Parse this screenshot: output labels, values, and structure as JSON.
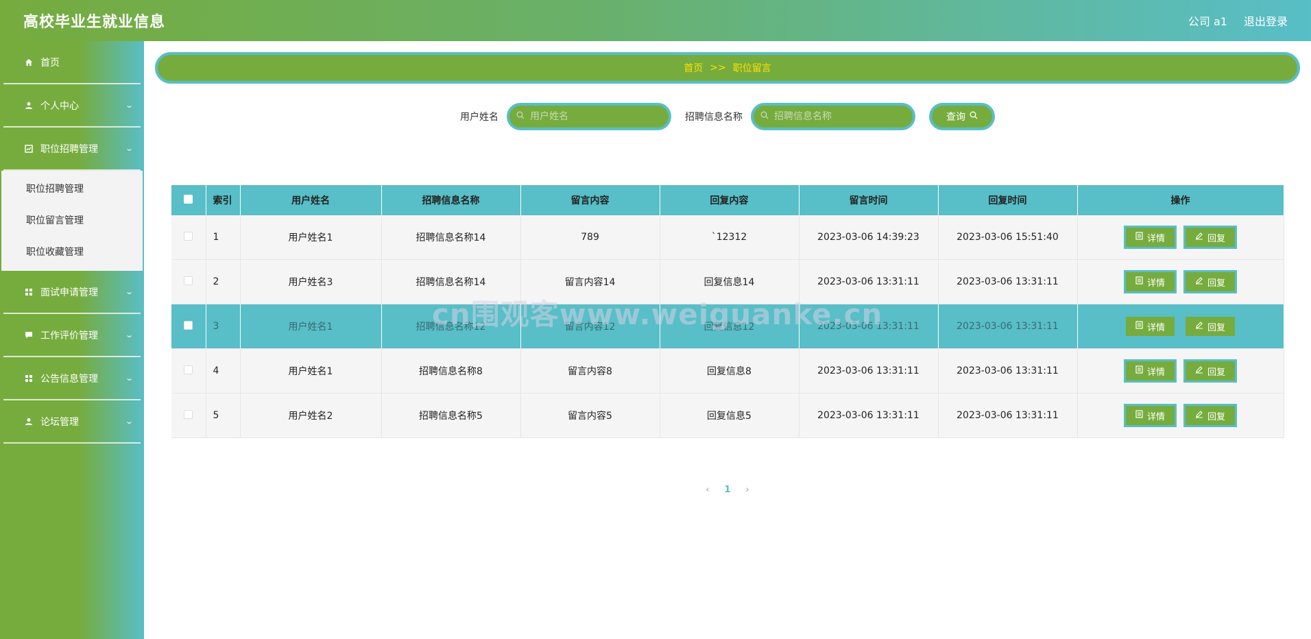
{
  "header": {
    "title": "高校毕业生就业信息",
    "user_label": "公司 a1",
    "logout_label": "退出登录"
  },
  "sidebar": {
    "items": [
      {
        "label": "首页",
        "icon": "home-icon",
        "has_chevron": false
      },
      {
        "label": "个人中心",
        "icon": "user-icon",
        "has_chevron": true
      },
      {
        "label": "职位招聘管理",
        "icon": "chart-icon",
        "has_chevron": true
      }
    ],
    "submenu": [
      {
        "label": "职位招聘管理"
      },
      {
        "label": "职位留言管理"
      },
      {
        "label": "职位收藏管理"
      }
    ],
    "items_after": [
      {
        "label": "面试申请管理",
        "icon": "grid-icon",
        "has_chevron": true
      },
      {
        "label": "工作评价管理",
        "icon": "message-icon",
        "has_chevron": true
      },
      {
        "label": "公告信息管理",
        "icon": "grid-icon",
        "has_chevron": true
      },
      {
        "label": "论坛管理",
        "icon": "user-icon",
        "has_chevron": true
      }
    ]
  },
  "breadcrumb": {
    "home": "首页",
    "sep": ">>",
    "current": "职位留言"
  },
  "search": {
    "username_label": "用户姓名",
    "username_placeholder": "用户姓名",
    "recruit_label": "招聘信息名称",
    "recruit_placeholder": "招聘信息名称",
    "query_label": "查询"
  },
  "table": {
    "columns": [
      "索引",
      "用户姓名",
      "招聘信息名称",
      "留言内容",
      "回复内容",
      "留言时间",
      "回复时间",
      "操作"
    ],
    "rows": [
      {
        "index": "1",
        "username": "用户姓名1",
        "recruit": "招聘信息名称14",
        "message": "789",
        "reply": "`12312",
        "msg_time": "2023-03-06 14:39:23",
        "reply_time": "2023-03-06 15:51:40",
        "highlight": false
      },
      {
        "index": "2",
        "username": "用户姓名3",
        "recruit": "招聘信息名称14",
        "message": "留言内容14",
        "reply": "回复信息14",
        "msg_time": "2023-03-06 13:31:11",
        "reply_time": "2023-03-06 13:31:11",
        "highlight": false
      },
      {
        "index": "3",
        "username": "用户姓名1",
        "recruit": "招聘信息名称12",
        "message": "留言内容12",
        "reply": "回复信息12",
        "msg_time": "2023-03-06 13:31:11",
        "reply_time": "2023-03-06 13:31:11",
        "highlight": true
      },
      {
        "index": "4",
        "username": "用户姓名1",
        "recruit": "招聘信息名称8",
        "message": "留言内容8",
        "reply": "回复信息8",
        "msg_time": "2023-03-06 13:31:11",
        "reply_time": "2023-03-06 13:31:11",
        "highlight": false
      },
      {
        "index": "5",
        "username": "用户姓名2",
        "recruit": "招聘信息名称5",
        "message": "留言内容5",
        "reply": "回复信息5",
        "msg_time": "2023-03-06 13:31:11",
        "reply_time": "2023-03-06 13:31:11",
        "highlight": false
      }
    ],
    "detail_label": "详情",
    "reply_label": "回复"
  },
  "pager": {
    "prev": "‹",
    "current": "1",
    "next": "›"
  },
  "watermark": "cn围观客www.weiguanke.cn",
  "colors": {
    "green": "#76ac3e",
    "teal": "#58bec7",
    "breadcrumb_text": "#ffe100"
  }
}
